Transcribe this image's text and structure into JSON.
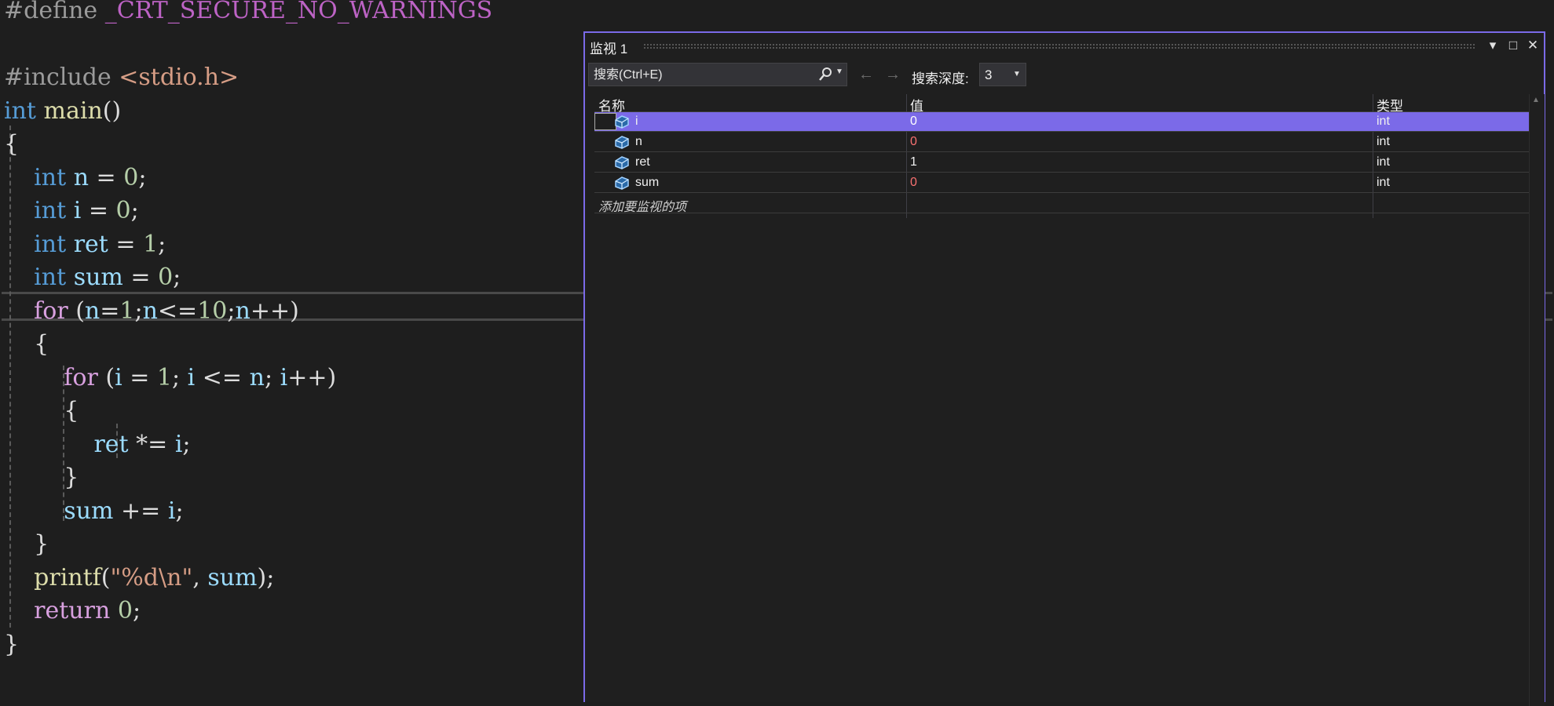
{
  "editor": {
    "lines": [
      {
        "tokens": [
          {
            "t": "#define ",
            "c": "t-pre"
          },
          {
            "t": "_CRT_SECURE_NO_WARNINGS",
            "c": "t-mac"
          }
        ]
      },
      {
        "tokens": []
      },
      {
        "tokens": [
          {
            "t": "#include ",
            "c": "t-pre"
          },
          {
            "t": "<stdio.h>",
            "c": "t-str"
          }
        ]
      },
      {
        "tokens": [
          {
            "t": "int",
            "c": "t-kw"
          },
          {
            "t": " ",
            "c": "t-punc"
          },
          {
            "t": "main",
            "c": "t-fn"
          },
          {
            "t": "()",
            "c": "t-punc"
          }
        ]
      },
      {
        "tokens": [
          {
            "t": "{",
            "c": "t-punc"
          }
        ]
      },
      {
        "tokens": [
          {
            "t": "    ",
            "c": "t-punc"
          },
          {
            "t": "int",
            "c": "t-kw"
          },
          {
            "t": " ",
            "c": "t-punc"
          },
          {
            "t": "n",
            "c": "t-var"
          },
          {
            "t": " = ",
            "c": "t-punc"
          },
          {
            "t": "0",
            "c": "t-num"
          },
          {
            "t": ";",
            "c": "t-punc"
          }
        ]
      },
      {
        "tokens": [
          {
            "t": "    ",
            "c": "t-punc"
          },
          {
            "t": "int",
            "c": "t-kw"
          },
          {
            "t": " ",
            "c": "t-punc"
          },
          {
            "t": "i",
            "c": "t-var"
          },
          {
            "t": " = ",
            "c": "t-punc"
          },
          {
            "t": "0",
            "c": "t-num"
          },
          {
            "t": ";",
            "c": "t-punc"
          }
        ]
      },
      {
        "tokens": [
          {
            "t": "    ",
            "c": "t-punc"
          },
          {
            "t": "int",
            "c": "t-kw"
          },
          {
            "t": " ",
            "c": "t-punc"
          },
          {
            "t": "ret",
            "c": "t-var"
          },
          {
            "t": " = ",
            "c": "t-punc"
          },
          {
            "t": "1",
            "c": "t-num"
          },
          {
            "t": ";",
            "c": "t-punc"
          }
        ]
      },
      {
        "tokens": [
          {
            "t": "    ",
            "c": "t-punc"
          },
          {
            "t": "int",
            "c": "t-kw"
          },
          {
            "t": " ",
            "c": "t-punc"
          },
          {
            "t": "sum",
            "c": "t-var"
          },
          {
            "t": " = ",
            "c": "t-punc"
          },
          {
            "t": "0",
            "c": "t-num"
          },
          {
            "t": ";",
            "c": "t-punc"
          }
        ]
      },
      {
        "tokens": [
          {
            "t": "    ",
            "c": "t-punc"
          },
          {
            "t": "for",
            "c": "t-ctrl"
          },
          {
            "t": " (",
            "c": "t-punc"
          },
          {
            "t": "n",
            "c": "t-var"
          },
          {
            "t": "=",
            "c": "t-punc"
          },
          {
            "t": "1",
            "c": "t-num"
          },
          {
            "t": ";",
            "c": "t-punc"
          },
          {
            "t": "n",
            "c": "t-var"
          },
          {
            "t": "<=",
            "c": "t-punc"
          },
          {
            "t": "10",
            "c": "t-num"
          },
          {
            "t": ";",
            "c": "t-punc"
          },
          {
            "t": "n",
            "c": "t-var"
          },
          {
            "t": "++)",
            "c": "t-punc"
          }
        ]
      },
      {
        "tokens": [
          {
            "t": "    {",
            "c": "t-punc"
          }
        ]
      },
      {
        "tokens": [
          {
            "t": "        ",
            "c": "t-punc"
          },
          {
            "t": "for",
            "c": "t-ctrl"
          },
          {
            "t": " (",
            "c": "t-punc"
          },
          {
            "t": "i",
            "c": "t-var"
          },
          {
            "t": " = ",
            "c": "t-punc"
          },
          {
            "t": "1",
            "c": "t-num"
          },
          {
            "t": "; ",
            "c": "t-punc"
          },
          {
            "t": "i",
            "c": "t-var"
          },
          {
            "t": " <= ",
            "c": "t-punc"
          },
          {
            "t": "n",
            "c": "t-var"
          },
          {
            "t": "; ",
            "c": "t-punc"
          },
          {
            "t": "i",
            "c": "t-var"
          },
          {
            "t": "++)",
            "c": "t-punc"
          }
        ]
      },
      {
        "tokens": [
          {
            "t": "        {",
            "c": "t-punc"
          }
        ]
      },
      {
        "tokens": [
          {
            "t": "            ",
            "c": "t-punc"
          },
          {
            "t": "ret",
            "c": "t-var"
          },
          {
            "t": " *= ",
            "c": "t-punc"
          },
          {
            "t": "i",
            "c": "t-var"
          },
          {
            "t": ";",
            "c": "t-punc"
          }
        ]
      },
      {
        "tokens": [
          {
            "t": "        }",
            "c": "t-punc"
          }
        ]
      },
      {
        "tokens": [
          {
            "t": "        ",
            "c": "t-punc"
          },
          {
            "t": "sum",
            "c": "t-var"
          },
          {
            "t": " += ",
            "c": "t-punc"
          },
          {
            "t": "i",
            "c": "t-var"
          },
          {
            "t": ";",
            "c": "t-punc"
          }
        ]
      },
      {
        "tokens": [
          {
            "t": "    }",
            "c": "t-punc"
          }
        ]
      },
      {
        "tokens": [
          {
            "t": "    ",
            "c": "t-punc"
          },
          {
            "t": "printf",
            "c": "t-fn"
          },
          {
            "t": "(",
            "c": "t-punc"
          },
          {
            "t": "\"%d\\n\"",
            "c": "t-str"
          },
          {
            "t": ", ",
            "c": "t-punc"
          },
          {
            "t": "sum",
            "c": "t-var"
          },
          {
            "t": ");",
            "c": "t-punc"
          }
        ]
      },
      {
        "tokens": [
          {
            "t": "    ",
            "c": "t-punc"
          },
          {
            "t": "return",
            "c": "t-ctrl"
          },
          {
            "t": " ",
            "c": "t-punc"
          },
          {
            "t": "0",
            "c": "t-num"
          },
          {
            "t": ";",
            "c": "t-punc"
          }
        ]
      },
      {
        "tokens": [
          {
            "t": "}",
            "c": "t-punc"
          }
        ]
      }
    ]
  },
  "watch": {
    "title": "监视 1",
    "window_buttons": {
      "dropdown": "▾",
      "maximize": "□",
      "close": "✕"
    },
    "search": {
      "placeholder": "搜索(Ctrl+E)",
      "icon": "search-icon"
    },
    "nav": {
      "back": "←",
      "forward": "→"
    },
    "depth": {
      "label": "搜索深度:",
      "value": "3"
    },
    "columns": {
      "name": "名称",
      "value": "值",
      "type": "类型"
    },
    "rows": [
      {
        "name": "i",
        "value": "0",
        "type": "int",
        "selected": true,
        "changed": true
      },
      {
        "name": "n",
        "value": "0",
        "type": "int",
        "selected": false,
        "changed": true
      },
      {
        "name": "ret",
        "value": "1",
        "type": "int",
        "selected": false,
        "changed": false
      },
      {
        "name": "sum",
        "value": "0",
        "type": "int",
        "selected": false,
        "changed": true
      }
    ],
    "add_item_text": "添加要监视的项"
  },
  "colors": {
    "accent": "#7b6ae8",
    "changed_value": "#f87171",
    "background": "#1e1e1e"
  }
}
